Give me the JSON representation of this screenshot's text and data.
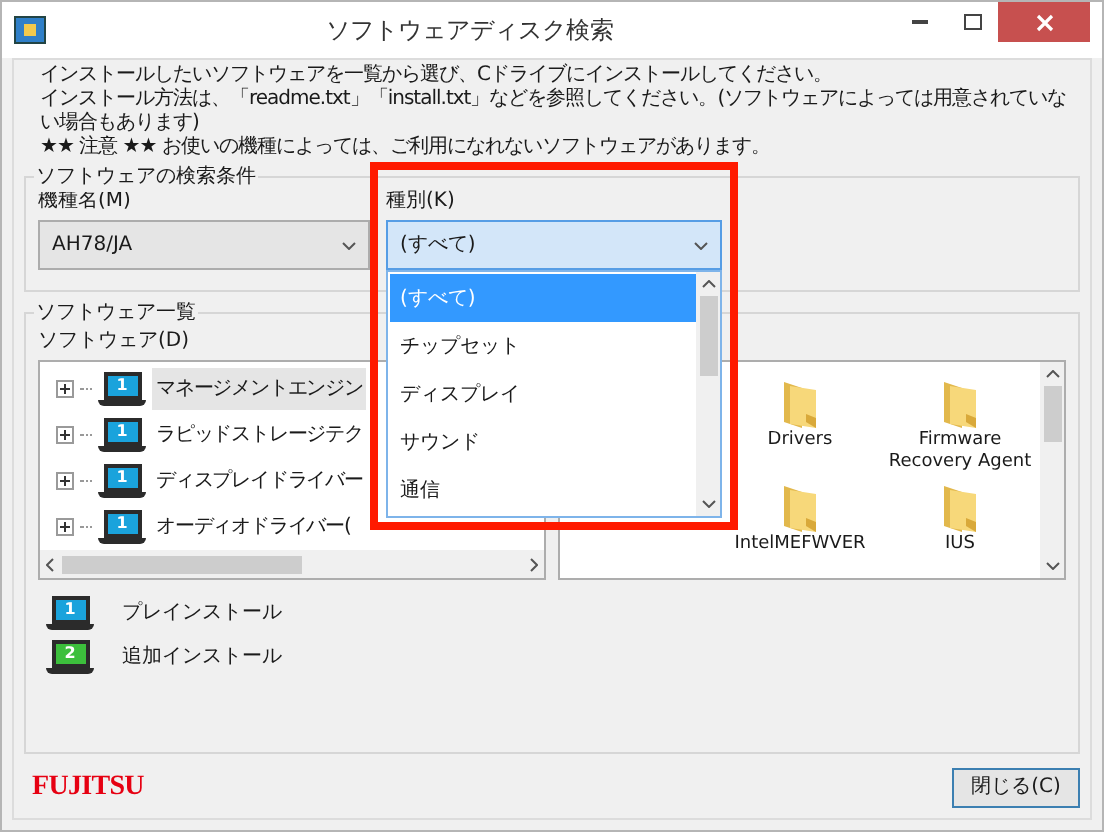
{
  "window": {
    "title": "ソフトウェアディスク検索"
  },
  "instructions": [
    "インストールしたいソフトウェアを一覧から選び、Cドライブにインストールしてください。",
    "インストール方法は、「readme.txt」「install.txt」などを参照してください。(ソフトウェアによっては用意されていない場合もあります)",
    "★★ 注意 ★★ お使いの機種によっては、ご利用になれないソフトウェアがあります。"
  ],
  "search_conditions": {
    "title": "ソフトウェアの検索条件",
    "model": {
      "label": "機種名(M)",
      "value": "AH78/JA"
    },
    "category": {
      "label": "種別(K)",
      "value": "(すべて)",
      "expanded": true,
      "highlighted": true,
      "options": [
        {
          "label": "(すべて)",
          "selected": true
        },
        {
          "label": "チップセット",
          "selected": false
        },
        {
          "label": "ディスプレイ",
          "selected": false
        },
        {
          "label": "サウンド",
          "selected": false
        },
        {
          "label": "通信",
          "selected": false
        }
      ]
    }
  },
  "software_list": {
    "title": "ソフトウェア一覧",
    "tree_label": "ソフトウェア(D)",
    "tree": [
      {
        "label": "マネージメントエンジン",
        "expanded": false,
        "selected": true,
        "kind": "preinstall",
        "badge": "1"
      },
      {
        "label": "ラピッドストレージテク",
        "expanded": false,
        "selected": false,
        "kind": "preinstall",
        "badge": "1"
      },
      {
        "label": "ディスプレイドライバー",
        "expanded": false,
        "selected": false,
        "kind": "preinstall",
        "badge": "1"
      },
      {
        "label": "オーディオドライバー(",
        "expanded": false,
        "selected": false,
        "kind": "preinstall",
        "badge": "1"
      }
    ],
    "folders": [
      {
        "label": "Drivers"
      },
      {
        "label": "Firmware Recovery Agent"
      },
      {
        "label": "IntelMEFWVER"
      },
      {
        "label": "IUS"
      }
    ]
  },
  "legend": [
    {
      "kind": "preinstall",
      "badge": "1",
      "label": "プレインストール"
    },
    {
      "kind": "additional",
      "badge": "2",
      "label": "追加インストール"
    }
  ],
  "logo": "FUJITSU",
  "buttons": [
    {
      "label": "閉じる(C)"
    }
  ]
}
